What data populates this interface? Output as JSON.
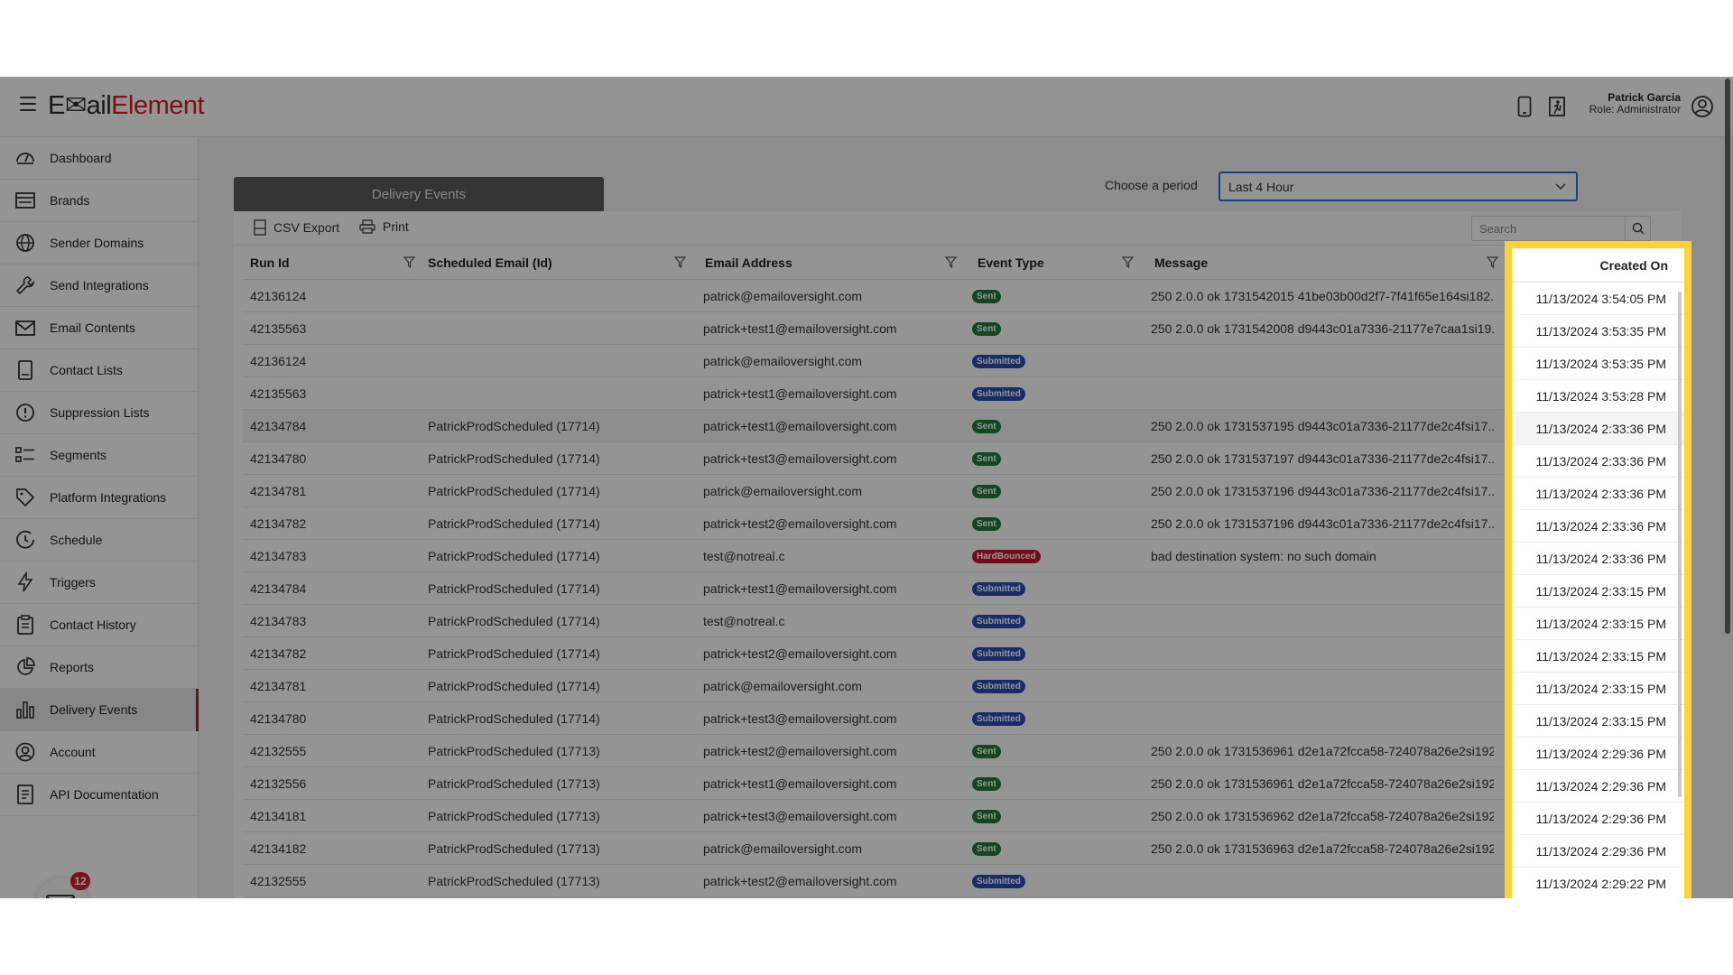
{
  "header": {
    "logo_part1": "E✉ail",
    "logo_part2": "Element",
    "user_name": "Patrick Garcia",
    "user_role": "Role: Administrator"
  },
  "sidebar": {
    "items": [
      {
        "label": "Dashboard",
        "icon": "gauge-icon"
      },
      {
        "label": "Brands",
        "icon": "brands-icon"
      },
      {
        "label": "Sender Domains",
        "icon": "globe-icon"
      },
      {
        "label": "Send Integrations",
        "icon": "wrench-icon"
      },
      {
        "label": "Email Contents",
        "icon": "envelope-icon"
      },
      {
        "label": "Contact Lists",
        "icon": "list-doc-icon"
      },
      {
        "label": "Suppression Lists",
        "icon": "alert-circle-icon"
      },
      {
        "label": "Segments",
        "icon": "segments-icon"
      },
      {
        "label": "Platform Integrations",
        "icon": "tag-icon"
      },
      {
        "label": "Schedule",
        "icon": "clock-icon"
      },
      {
        "label": "Triggers",
        "icon": "lightning-icon"
      },
      {
        "label": "Contact History",
        "icon": "clipboard-icon"
      },
      {
        "label": "Reports",
        "icon": "pie-chart-icon"
      },
      {
        "label": "Delivery Events",
        "icon": "bar-chart-icon"
      },
      {
        "label": "Account",
        "icon": "user-circle-icon"
      },
      {
        "label": "API Documentation",
        "icon": "document-icon"
      }
    ],
    "active_label": "Delivery Events",
    "notification_count": "12"
  },
  "main": {
    "tab_label": "Delivery Events",
    "period_label": "Choose a period",
    "period_value": "Last 4 Hour",
    "csv_export_label": "CSV Export",
    "print_label": "Print",
    "search_placeholder": "Search"
  },
  "table": {
    "columns": [
      "Run Id",
      "Scheduled Email (Id)",
      "Email Address",
      "Event Type",
      "Message",
      "Created On"
    ],
    "rows": [
      [
        "42136124",
        "",
        "patrick@emailoversight.com",
        "Sent",
        "250 2.0.0 ok 1731542015 41be03b00d2f7-7f41f65e164si182...",
        "11/13/2024 3:54:05 PM"
      ],
      [
        "42135563",
        "",
        "patrick+test1@emailoversight.com",
        "Sent",
        "250 2.0.0 ok 1731542008 d9443c01a7336-21177e7caa1si19...",
        "11/13/2024 3:53:35 PM"
      ],
      [
        "42136124",
        "",
        "patrick@emailoversight.com",
        "Submitted",
        "",
        "11/13/2024 3:53:35 PM"
      ],
      [
        "42135563",
        "",
        "patrick+test1@emailoversight.com",
        "Submitted",
        "",
        "11/13/2024 3:53:28 PM"
      ],
      [
        "42134784",
        "PatrickProdScheduled (17714)",
        "patrick+test1@emailoversight.com",
        "Sent",
        "250 2.0.0 ok 1731537195 d9443c01a7336-21177de2c4fsi17...",
        "11/13/2024 2:33:36 PM"
      ],
      [
        "42134780",
        "PatrickProdScheduled (17714)",
        "patrick+test3@emailoversight.com",
        "Sent",
        "250 2.0.0 ok 1731537197 d9443c01a7336-21177de2c4fsi17...",
        "11/13/2024 2:33:36 PM"
      ],
      [
        "42134781",
        "PatrickProdScheduled (17714)",
        "patrick@emailoversight.com",
        "Sent",
        "250 2.0.0 ok 1731537196 d9443c01a7336-21177de2c4fsi17...",
        "11/13/2024 2:33:36 PM"
      ],
      [
        "42134782",
        "PatrickProdScheduled (17714)",
        "patrick+test2@emailoversight.com",
        "Sent",
        "250 2.0.0 ok 1731537196 d9443c01a7336-21177de2c4fsi17...",
        "11/13/2024 2:33:36 PM"
      ],
      [
        "42134783",
        "PatrickProdScheduled (17714)",
        "test@notreal.c",
        "HardBounced",
        "bad destination system: no such domain",
        "11/13/2024 2:33:36 PM"
      ],
      [
        "42134784",
        "PatrickProdScheduled (17714)",
        "patrick+test1@emailoversight.com",
        "Submitted",
        "",
        "11/13/2024 2:33:15 PM"
      ],
      [
        "42134783",
        "PatrickProdScheduled (17714)",
        "test@notreal.c",
        "Submitted",
        "",
        "11/13/2024 2:33:15 PM"
      ],
      [
        "42134782",
        "PatrickProdScheduled (17714)",
        "patrick+test2@emailoversight.com",
        "Submitted",
        "",
        "11/13/2024 2:33:15 PM"
      ],
      [
        "42134781",
        "PatrickProdScheduled (17714)",
        "patrick@emailoversight.com",
        "Submitted",
        "",
        "11/13/2024 2:33:15 PM"
      ],
      [
        "42134780",
        "PatrickProdScheduled (17714)",
        "patrick+test3@emailoversight.com",
        "Submitted",
        "",
        "11/13/2024 2:33:15 PM"
      ],
      [
        "42132555",
        "PatrickProdScheduled (17713)",
        "patrick+test2@emailoversight.com",
        "Sent",
        "250 2.0.0 ok 1731536961 d2e1a72fcca58-724078a26e2si192...",
        "11/13/2024 2:29:36 PM"
      ],
      [
        "42132556",
        "PatrickProdScheduled (17713)",
        "patrick+test1@emailoversight.com",
        "Sent",
        "250 2.0.0 ok 1731536961 d2e1a72fcca58-724078a26e2si192...",
        "11/13/2024 2:29:36 PM"
      ],
      [
        "42134181",
        "PatrickProdScheduled (17713)",
        "patrick+test3@emailoversight.com",
        "Sent",
        "250 2.0.0 ok 1731536962 d2e1a72fcca58-724078a26e2si192...",
        "11/13/2024 2:29:36 PM"
      ],
      [
        "42134182",
        "PatrickProdScheduled (17713)",
        "patrick@emailoversight.com",
        "Sent",
        "250 2.0.0 ok 1731536963 d2e1a72fcca58-724078a26e2si192...",
        "11/13/2024 2:29:36 PM"
      ],
      [
        "42132555",
        "PatrickProdScheduled (17713)",
        "patrick+test2@emailoversight.com",
        "Submitted",
        "",
        "11/13/2024 2:29:22 PM"
      ]
    ],
    "highlight_row_index": 4
  },
  "badge_colors": {
    "Sent": "#1f7a3a",
    "Submitted": "#2a4fb3",
    "HardBounced": "#c3162d"
  },
  "colors": {
    "brand_red": "#d21f2b",
    "highlight_border": "#fdd234",
    "select_border": "#2e6fd1"
  }
}
